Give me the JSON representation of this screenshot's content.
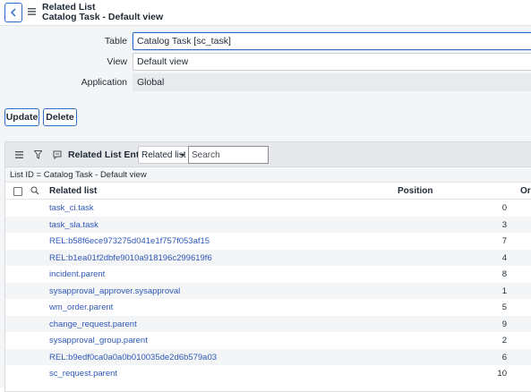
{
  "header": {
    "title": "Related List",
    "subtitle": "Catalog Task - Default view"
  },
  "form": {
    "table_label": "Table",
    "table_value": "Catalog Task [sc_task]",
    "view_label": "View",
    "view_value": "Default view",
    "application_label": "Application",
    "application_value": "Global"
  },
  "buttons": {
    "update": "Update",
    "delete": "Delete"
  },
  "list": {
    "title": "Related List Entries",
    "filter_select": "Related list",
    "search_placeholder": "Search",
    "list_id": "List ID = Catalog Task - Default view",
    "columns": [
      "Related list",
      "Position",
      "Or"
    ],
    "rows": [
      {
        "name": "task_ci.task",
        "position": "0"
      },
      {
        "name": "task_sla.task",
        "position": "3"
      },
      {
        "name": "REL:b58f6ece973275d041e1f757f053af15",
        "position": "7"
      },
      {
        "name": "REL:b1ea01f2dbfe9010a918196c299619f6",
        "position": "4"
      },
      {
        "name": "incident.parent",
        "position": "8"
      },
      {
        "name": "sysapproval_approver.sysapproval",
        "position": "1"
      },
      {
        "name": "wm_order.parent",
        "position": "5"
      },
      {
        "name": "change_request.parent",
        "position": "9"
      },
      {
        "name": "sysapproval_group.parent",
        "position": "2"
      },
      {
        "name": "REL:b9edf0ca0a0a0b010035de2d6b579a03",
        "position": "6"
      },
      {
        "name": "sc_request.parent",
        "position": "10"
      }
    ]
  }
}
